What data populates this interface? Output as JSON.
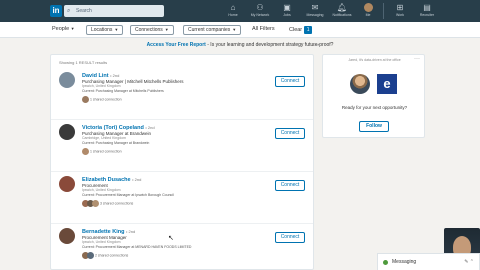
{
  "nav": {
    "logo": "in",
    "search_placeholder": "Search",
    "items": [
      {
        "label": "Home",
        "icon": "home-icon"
      },
      {
        "label": "My Network",
        "icon": "network-icon"
      },
      {
        "label": "Jobs",
        "icon": "jobs-icon"
      },
      {
        "label": "Messaging",
        "icon": "messaging-icon"
      },
      {
        "label": "Notifications",
        "icon": "bell-icon"
      },
      {
        "label": "Me",
        "icon": "avatar"
      },
      {
        "label": "Work",
        "icon": "grid-icon"
      },
      {
        "label": "Recruiter",
        "icon": "recruiter-icon"
      }
    ]
  },
  "filters": {
    "people": "People",
    "locations": "Locations",
    "connections": "Connections",
    "current_companies": "Current companies",
    "all_filters": "All Filters",
    "clear": "Clear",
    "clear_count": "1"
  },
  "promo": {
    "link": "Access Your Free Report",
    "text": " - Is your learning and development strategy future-proof?",
    "ad": "Ad"
  },
  "results": {
    "showing": "Showing 1 RESULT results",
    "connect_label": "Connect",
    "items": [
      {
        "name": "David Lint",
        "degree": "• 2nd",
        "title": "Purchasing Manager | Mitchell Mitchells Publishers",
        "location": "Ipswich, United Kingdom",
        "current": "Current: Purchasing Manager at Mitchells Publishers",
        "shared": "1 shared connection",
        "avatar_color": "#7a8c9c"
      },
      {
        "name": "Victoria (Tori) Copeland",
        "degree": "• 2nd",
        "title": "Purchasing Manager at Brandwein",
        "location": "Cambridge, United Kingdom",
        "current": "Current: Purchasing Manager at Brandwein",
        "shared": "1 shared connection",
        "avatar_color": "#3a3a3a"
      },
      {
        "name": "Elizabeth Dusache",
        "degree": "• 2nd",
        "title": "Procurement",
        "location": "Ipswich, United Kingdom",
        "current": "Current: Procurement Manager at Ipswich Borough Council",
        "shared": "3 shared connections",
        "avatar_color": "#8a4a3a"
      },
      {
        "name": "Bernadette King",
        "degree": "• 2nd",
        "title": "Procurement Manager",
        "location": "Ipswich, United Kingdom",
        "current": "Current: Procurement Manager at MENARD HAVEN FOODS LIMITED",
        "shared": "2 shared connections",
        "avatar_color": "#6a4a3a"
      }
    ]
  },
  "ad_card": {
    "top_text": "Jared, it's data-driven at the office",
    "logo_letter": "e",
    "text": "Ready for your next opportunity?",
    "follow": "Follow"
  },
  "messaging": {
    "label": "Messaging"
  }
}
